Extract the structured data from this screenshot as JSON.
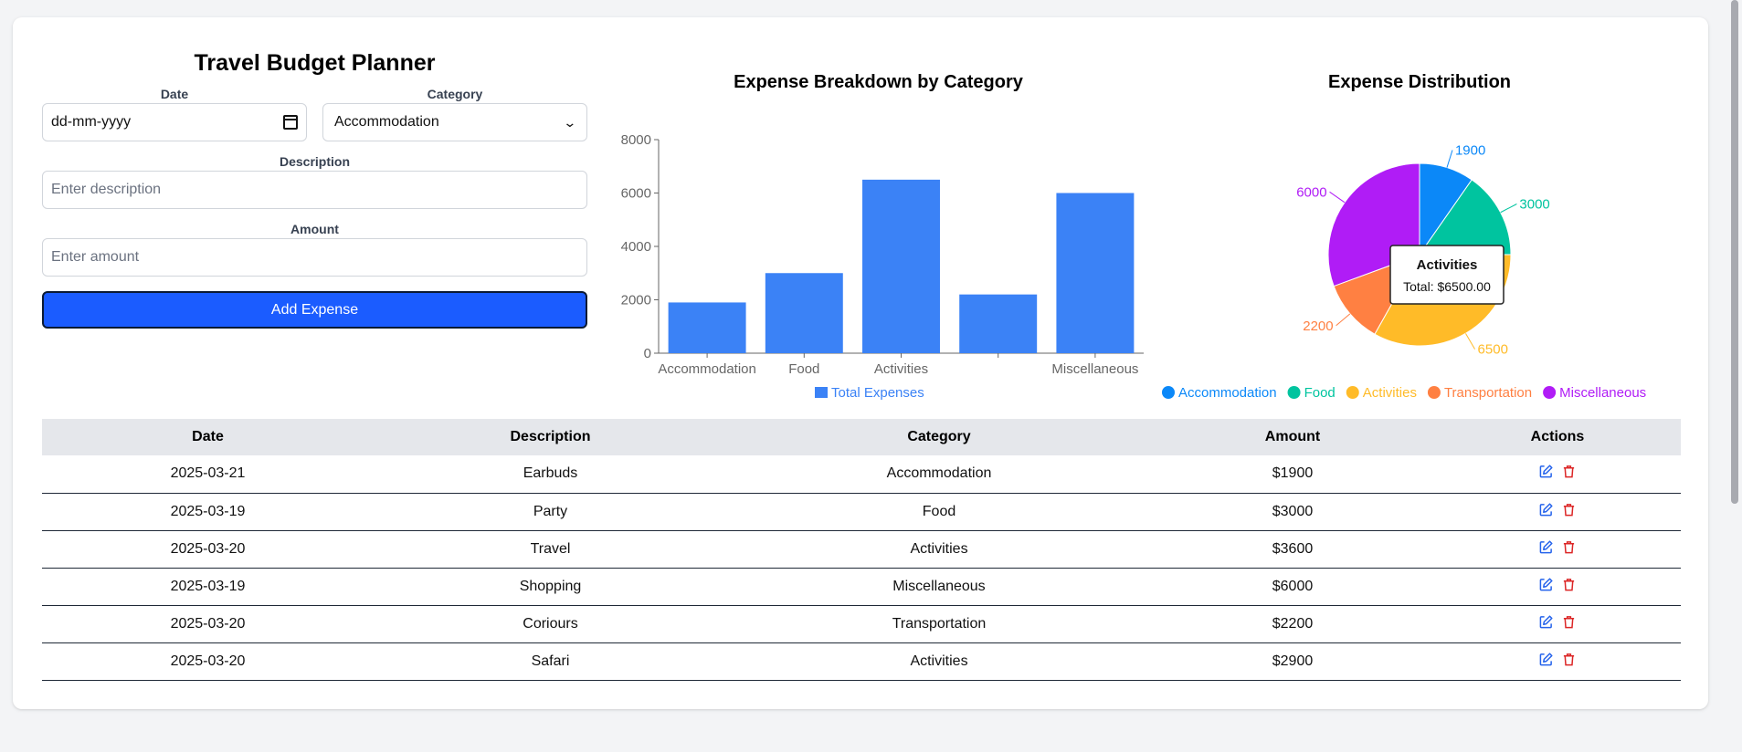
{
  "form": {
    "title": "Travel Budget Planner",
    "date_label": "Date",
    "date_value": "dd-mm-yyyy",
    "category_label": "Category",
    "category_value": "Accommodation",
    "description_label": "Description",
    "description_placeholder": "Enter description",
    "amount_label": "Amount",
    "amount_placeholder": "Enter amount",
    "add_button": "Add Expense",
    "button_color": "#1b5cff"
  },
  "bar_chart": {
    "title": "Expense Breakdown by Category",
    "legend": "Total Expenses"
  },
  "pie_chart": {
    "title": "Expense Distribution",
    "tooltip_title": "Activities",
    "tooltip_value": "Total: $6500.00"
  },
  "chart_data": [
    {
      "type": "bar",
      "title": "Expense Breakdown by Category",
      "categories": [
        "Accommodation",
        "Food",
        "Activities",
        "Transportation",
        "Miscellaneous"
      ],
      "tick_labels": [
        "Accommodation",
        "Food",
        "Activities",
        "",
        "Miscellaneous"
      ],
      "series": [
        {
          "name": "Total Expenses",
          "values": [
            1900,
            3000,
            6500,
            2200,
            6000
          ]
        }
      ],
      "y_ticks": [
        "0",
        "2000",
        "4000",
        "6000",
        "8000"
      ],
      "ylim": [
        0,
        8000
      ],
      "color": "#3b82f6",
      "legend_placement": "bottom"
    },
    {
      "type": "pie",
      "title": "Expense Distribution",
      "labels": [
        "Accommodation",
        "Food",
        "Activities",
        "Transportation",
        "Miscellaneous"
      ],
      "values": [
        1900,
        3000,
        6500,
        2200,
        6000
      ],
      "value_labels": [
        "1900",
        "3000",
        "6500",
        "2200",
        "6000"
      ],
      "colors": [
        "#0b88f8",
        "#00c49f",
        "#ffbb28",
        "#ff8042",
        "#b01cf6"
      ],
      "legend_placement": "bottom"
    }
  ],
  "table": {
    "headers": [
      "Date",
      "Description",
      "Category",
      "Amount",
      "Actions"
    ],
    "rows": [
      {
        "date": "2025-03-21",
        "description": "Earbuds",
        "category": "Accommodation",
        "amount": "$1900"
      },
      {
        "date": "2025-03-19",
        "description": "Party",
        "category": "Food",
        "amount": "$3000"
      },
      {
        "date": "2025-03-20",
        "description": "Travel",
        "category": "Activities",
        "amount": "$3600"
      },
      {
        "date": "2025-03-19",
        "description": "Shopping",
        "category": "Miscellaneous",
        "amount": "$6000"
      },
      {
        "date": "2025-03-20",
        "description": "Coriours",
        "category": "Transportation",
        "amount": "$2200"
      },
      {
        "date": "2025-03-20",
        "description": "Safari",
        "category": "Activities",
        "amount": "$2900"
      }
    ],
    "edit_icon": "edit-icon",
    "delete_icon": "trash-icon",
    "edit_color": "#2563eb",
    "delete_color": "#dc2626"
  }
}
